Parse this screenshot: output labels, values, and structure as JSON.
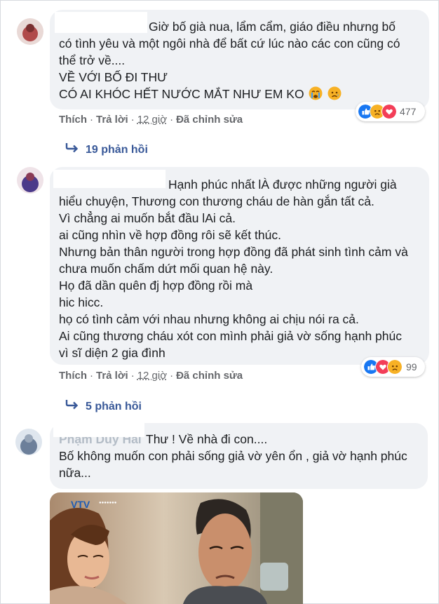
{
  "comments": [
    {
      "lines": [
        "Giờ bố già nua, lẩm cẩm, giáo điều nhưng bố",
        "có tình yêu và một ngôi nhà để bất cứ lúc nào các con cũng có",
        "thể trở về....",
        "VỀ VỚI BỐ ĐI THƯ",
        "CÓ AI KHÓC HẾT NƯỚC MẮT NHƯ EM KO"
      ],
      "actions": {
        "like": "Thích",
        "reply": "Trả lời",
        "time": "12 giờ",
        "edited": "Đã chỉnh sửa"
      },
      "reaction_count": "477",
      "reaction_icons": [
        "like-icon",
        "sad-icon",
        "love-icon"
      ],
      "replies_label": "19 phản hồi"
    },
    {
      "lines": [
        "Hạnh phúc nhất lÀ được những người già",
        "hiểu chuyện, Thương con thương cháu de hàn gắn tất cả.",
        "Vì chẳng ai muốn bắt đầu lAi cả.",
        "ai cũng nhìn về hợp đồng rôi sẽ kết thúc.",
        "Nhưng bản thân người trong hợp đồng đã phát sinh tình cảm và",
        "chưa muốn chấm dứt mối quan hệ này.",
        "Họ đã dần quên đj hợp đồng rồi mà",
        "hic hicc.",
        "họ có tình cảm với nhau nhưng không ai chịu nói ra cả.",
        "Ai cũng thương cháu xót con mình phải giả vờ sống hạnh phúc",
        "vì sĩ diện 2 gia đình"
      ],
      "actions": {
        "like": "Thích",
        "reply": "Trả lời",
        "time": "12 giờ",
        "edited": "Đã chỉnh sửa"
      },
      "reaction_count": "99",
      "reaction_icons": [
        "like-icon",
        "love-icon",
        "sad-icon"
      ],
      "replies_label": "5 phản hồi"
    },
    {
      "author_partial": "Phạm Duy Hải",
      "lines": [
        "Thư ! Về nhà đi con....",
        "Bố không muốn con phải sống giả vờ yên ổn , giả vờ hạnh phúc",
        "nữa..."
      ]
    }
  ],
  "colors": {
    "bubble": "#f0f2f5",
    "link": "#385898",
    "meta": "#65676b",
    "like": "#1877f2",
    "love": "#f33e58",
    "sad": "#f7b125"
  }
}
